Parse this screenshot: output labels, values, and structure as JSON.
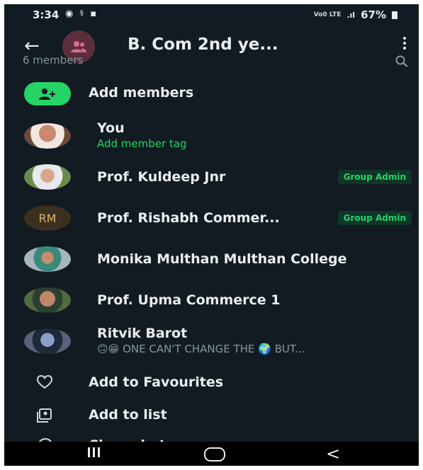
{
  "status_bar": {
    "time": "3:34",
    "network": "Vo0 LTE",
    "battery": "67%"
  },
  "header": {
    "title": "B. Com 2nd ye...",
    "members_count": "6 members"
  },
  "add_members": {
    "label": "Add members"
  },
  "members": [
    {
      "name": "You",
      "sub": "Add member tag",
      "badge": ""
    },
    {
      "name": "Prof. Kuldeep Jnr",
      "sub": "",
      "badge": "Group Admin"
    },
    {
      "name": "Prof. Rishabh Commer...",
      "sub": "",
      "badge": "Group Admin",
      "initials": "RM"
    },
    {
      "name": "Monika Multhan Multhan College",
      "sub": "",
      "badge": ""
    },
    {
      "name": "Prof. Upma Commerce 1",
      "sub": "",
      "badge": ""
    },
    {
      "name": "Ritvik Barot",
      "sub": "ONE CAN'T CHANGE THE",
      "sub_end": "BUT...",
      "badge": ""
    }
  ],
  "actions": {
    "favourites": "Add to Favourites",
    "add_to_list": "Add to list",
    "clear_chat": "Clear chat"
  },
  "colors": {
    "background": "#111b21",
    "accent_green": "#25d366",
    "badge_bg": "#103629",
    "secondary_text": "#8696a0"
  }
}
